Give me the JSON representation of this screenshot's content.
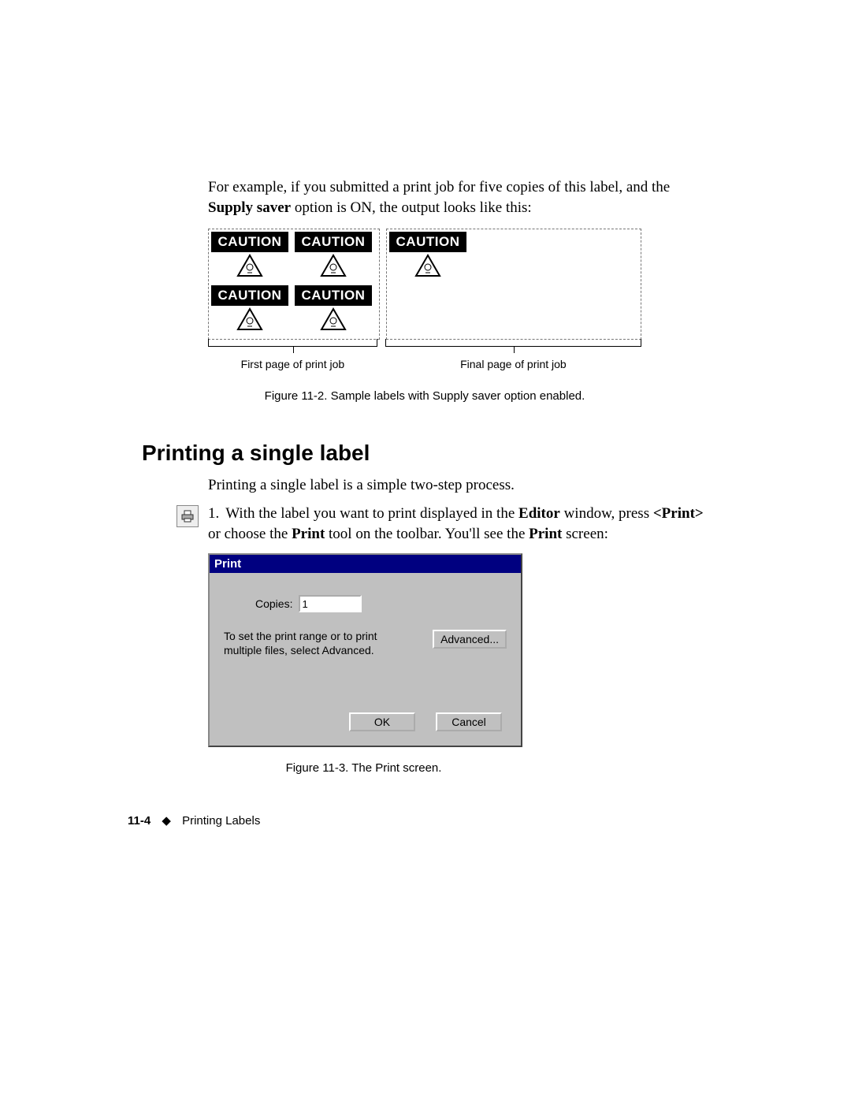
{
  "intro": {
    "line1_pre": "For example, if you submitted a print job for five copies of this label, and the ",
    "bold1": "Supply saver",
    "line1_post": " option is ON, the output looks like this:"
  },
  "caution_text": "CAUTION",
  "bracket_labels": {
    "first": "First page of print job",
    "final": "Final page of print job"
  },
  "figure1_caption": "Figure 11-2. Sample labels with Supply saver option enabled.",
  "section_heading": "Printing a single label",
  "para2": "Printing a single label is a simple two-step process.",
  "step1": {
    "num": "1.",
    "pre": "With the label you want to print displayed in the ",
    "bold_editor": "Editor",
    "mid1": " window, press ",
    "bold_print_key": "<Print>",
    "mid2": " or choose the ",
    "bold_print_tool": "Print",
    "mid3": " tool on the toolbar. You'll see the ",
    "bold_print_screen": "Print",
    "post": " screen:"
  },
  "dialog": {
    "title": "Print",
    "copies_label": "Copies:",
    "copies_value": "1",
    "advice": "To set the print range or to print multiple files, select Advanced.",
    "advanced_btn": "Advanced...",
    "ok_btn": "OK",
    "cancel_btn": "Cancel"
  },
  "figure2_caption": "Figure 11-3. The Print screen.",
  "footer": {
    "page": "11-4",
    "diamond": "◆",
    "chapter": "Printing Labels"
  }
}
